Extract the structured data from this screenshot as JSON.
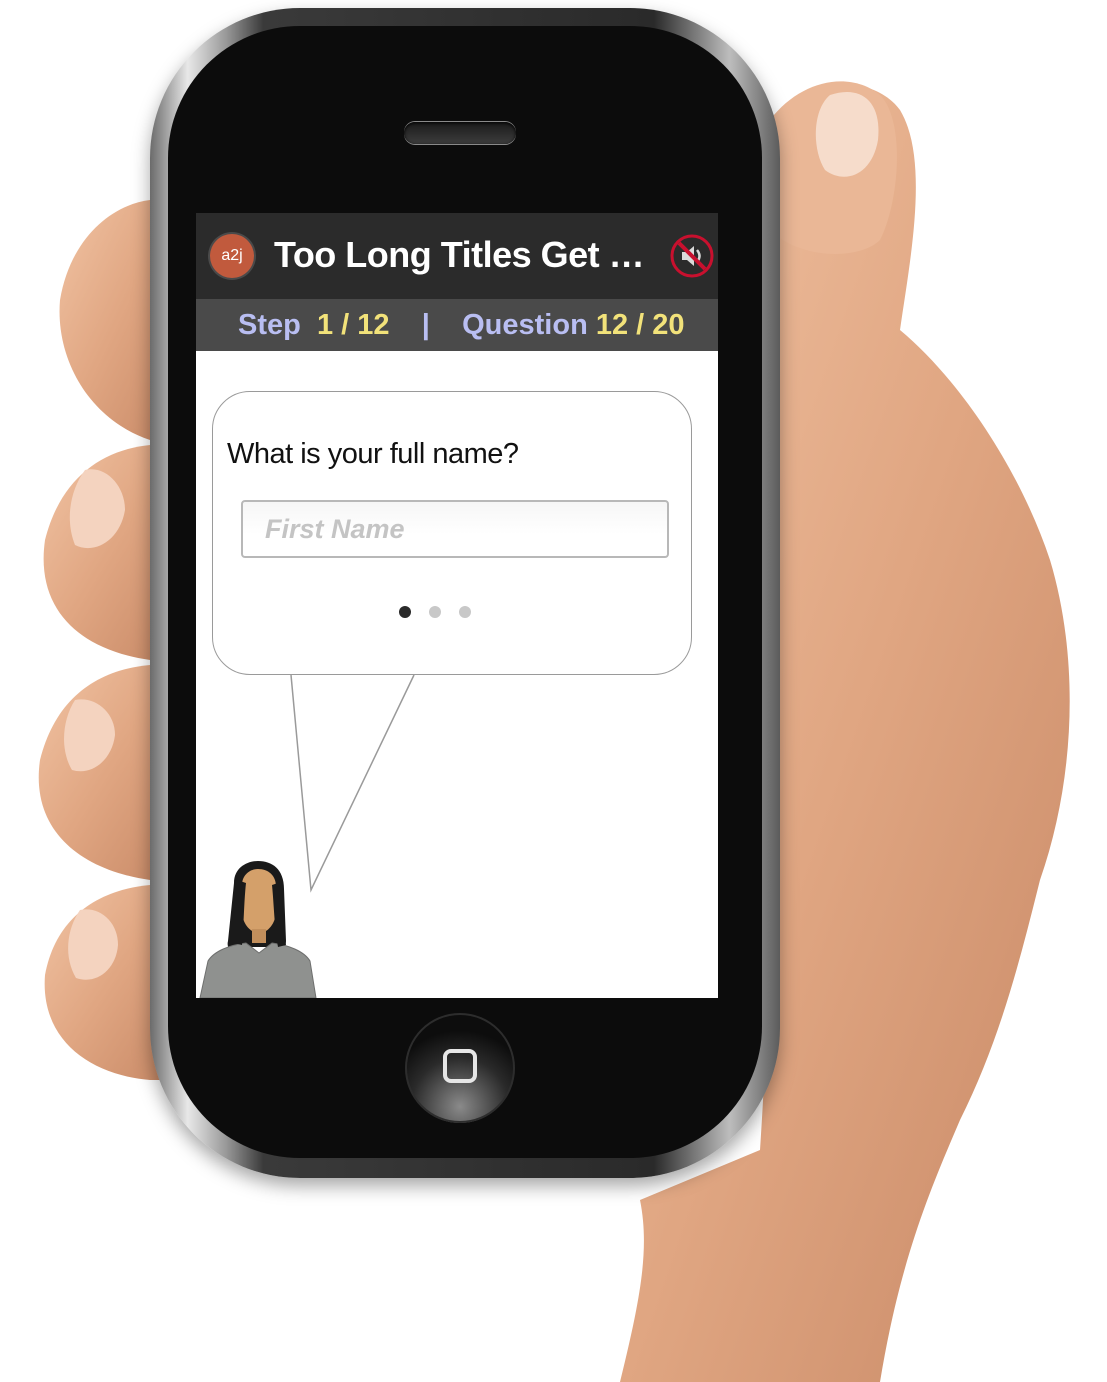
{
  "app": {
    "logo_text": "a2j",
    "title": "Too Long Titles Get Cu...",
    "mute_icon": "speaker-muted-icon"
  },
  "progress": {
    "step_label": "Step",
    "step_value": "1 / 12",
    "separator": "|",
    "question_label": "Question",
    "question_value": "12 / 20"
  },
  "question": {
    "prompt": "What is your full name?",
    "input_placeholder": "First Name",
    "input_value": "",
    "pager": {
      "count": 3,
      "active_index": 0
    }
  },
  "device": {
    "home_icon": "home-square-icon"
  },
  "colors": {
    "title_bar": "#2b2b2b",
    "progress_bar": "#4a4a4a",
    "progress_label": "#b9bef2",
    "progress_value": "#f2e27a",
    "logo": "#c15a3d"
  }
}
